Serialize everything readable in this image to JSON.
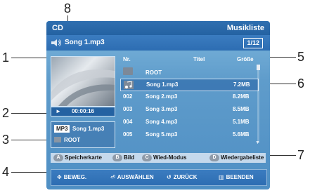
{
  "callouts": [
    "1",
    "2",
    "3",
    "4",
    "5",
    "6",
    "7",
    "8"
  ],
  "header": {
    "left": "CD",
    "right": "Musikliste"
  },
  "now_playing": {
    "title": "Song 1.mp3",
    "counter": "1/12",
    "time": "00:00:16"
  },
  "info": {
    "format": "MP3",
    "filename": "Song 1.mp3",
    "folder": "ROOT"
  },
  "list": {
    "columns": {
      "nr": "Nr.",
      "title": "Titel",
      "size": "Größe"
    },
    "folder_row": {
      "title": "ROOT"
    },
    "rows": [
      {
        "nr": "",
        "title": "Song 1.mp3",
        "size": "7.2MB",
        "selected": true
      },
      {
        "nr": "002",
        "title": "Song 2.mp3",
        "size": "8.2MB"
      },
      {
        "nr": "003",
        "title": "Song 3.mp3",
        "size": "8.5MB"
      },
      {
        "nr": "004",
        "title": "Song 4.mp3",
        "size": "5.1MB"
      },
      {
        "nr": "005",
        "title": "Song 5.mp3",
        "size": "5.6MB"
      }
    ]
  },
  "color_keys": [
    {
      "key": "A",
      "label": "Speicherkarte"
    },
    {
      "key": "B",
      "label": "Bild"
    },
    {
      "key": "C",
      "label": "Wied-Modus"
    },
    {
      "key": "D",
      "label": "Wiedergabeliste"
    }
  ],
  "nav": [
    {
      "symbol": "✥",
      "label": "BEWEG."
    },
    {
      "symbol": "⏎",
      "label": "AUSWÄHLEN"
    },
    {
      "symbol": "↺",
      "label": "ZURÜCK"
    },
    {
      "symbol": "▥",
      "label": "BEENDEN"
    }
  ]
}
